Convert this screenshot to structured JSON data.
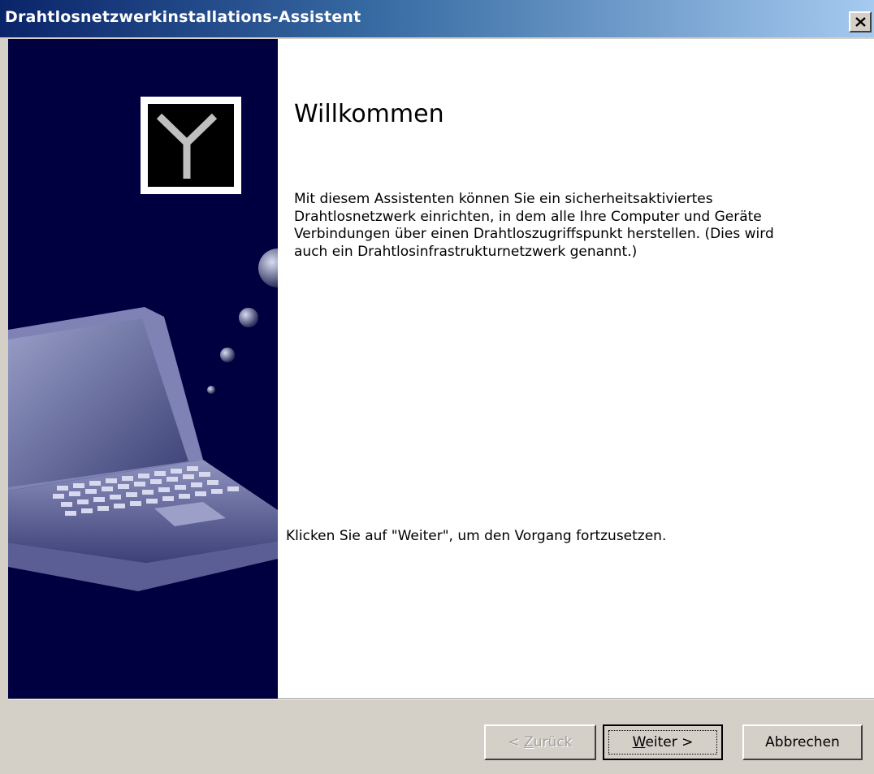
{
  "window": {
    "title": "Drahtlosnetzwerkinstallations-Assistent",
    "close_label": "close"
  },
  "page": {
    "heading": "Willkommen",
    "description": "Mit diesem Assistenten können Sie ein sicherheitsaktiviertes Drahtlosnetzwerk einrichten, in dem alle Ihre Computer und Geräte Verbindungen über einen Drahtloszugriffspunkt herstellen. (Dies wird auch ein Drahtlosinfrastrukturnetzwerk genannt.)",
    "hint": "Klicken Sie auf \"Weiter\", um den Vorgang fortzusetzen."
  },
  "buttons": {
    "back": {
      "prefix": "< ",
      "mnemonic": "Z",
      "rest": "urück",
      "enabled": false
    },
    "next": {
      "mnemonic": "W",
      "rest": "eiter >",
      "enabled": true,
      "default": true
    },
    "cancel": {
      "label": "Abbrechen",
      "enabled": true
    }
  },
  "colors": {
    "panel": "#000040",
    "titlebar_start": "#0a246a",
    "titlebar_end": "#a6caf0",
    "face": "#d4d0c8"
  },
  "icons": {
    "close": "close-x-icon",
    "logo": "wireless-antenna-icon",
    "illustration": "laptop-illustration"
  }
}
